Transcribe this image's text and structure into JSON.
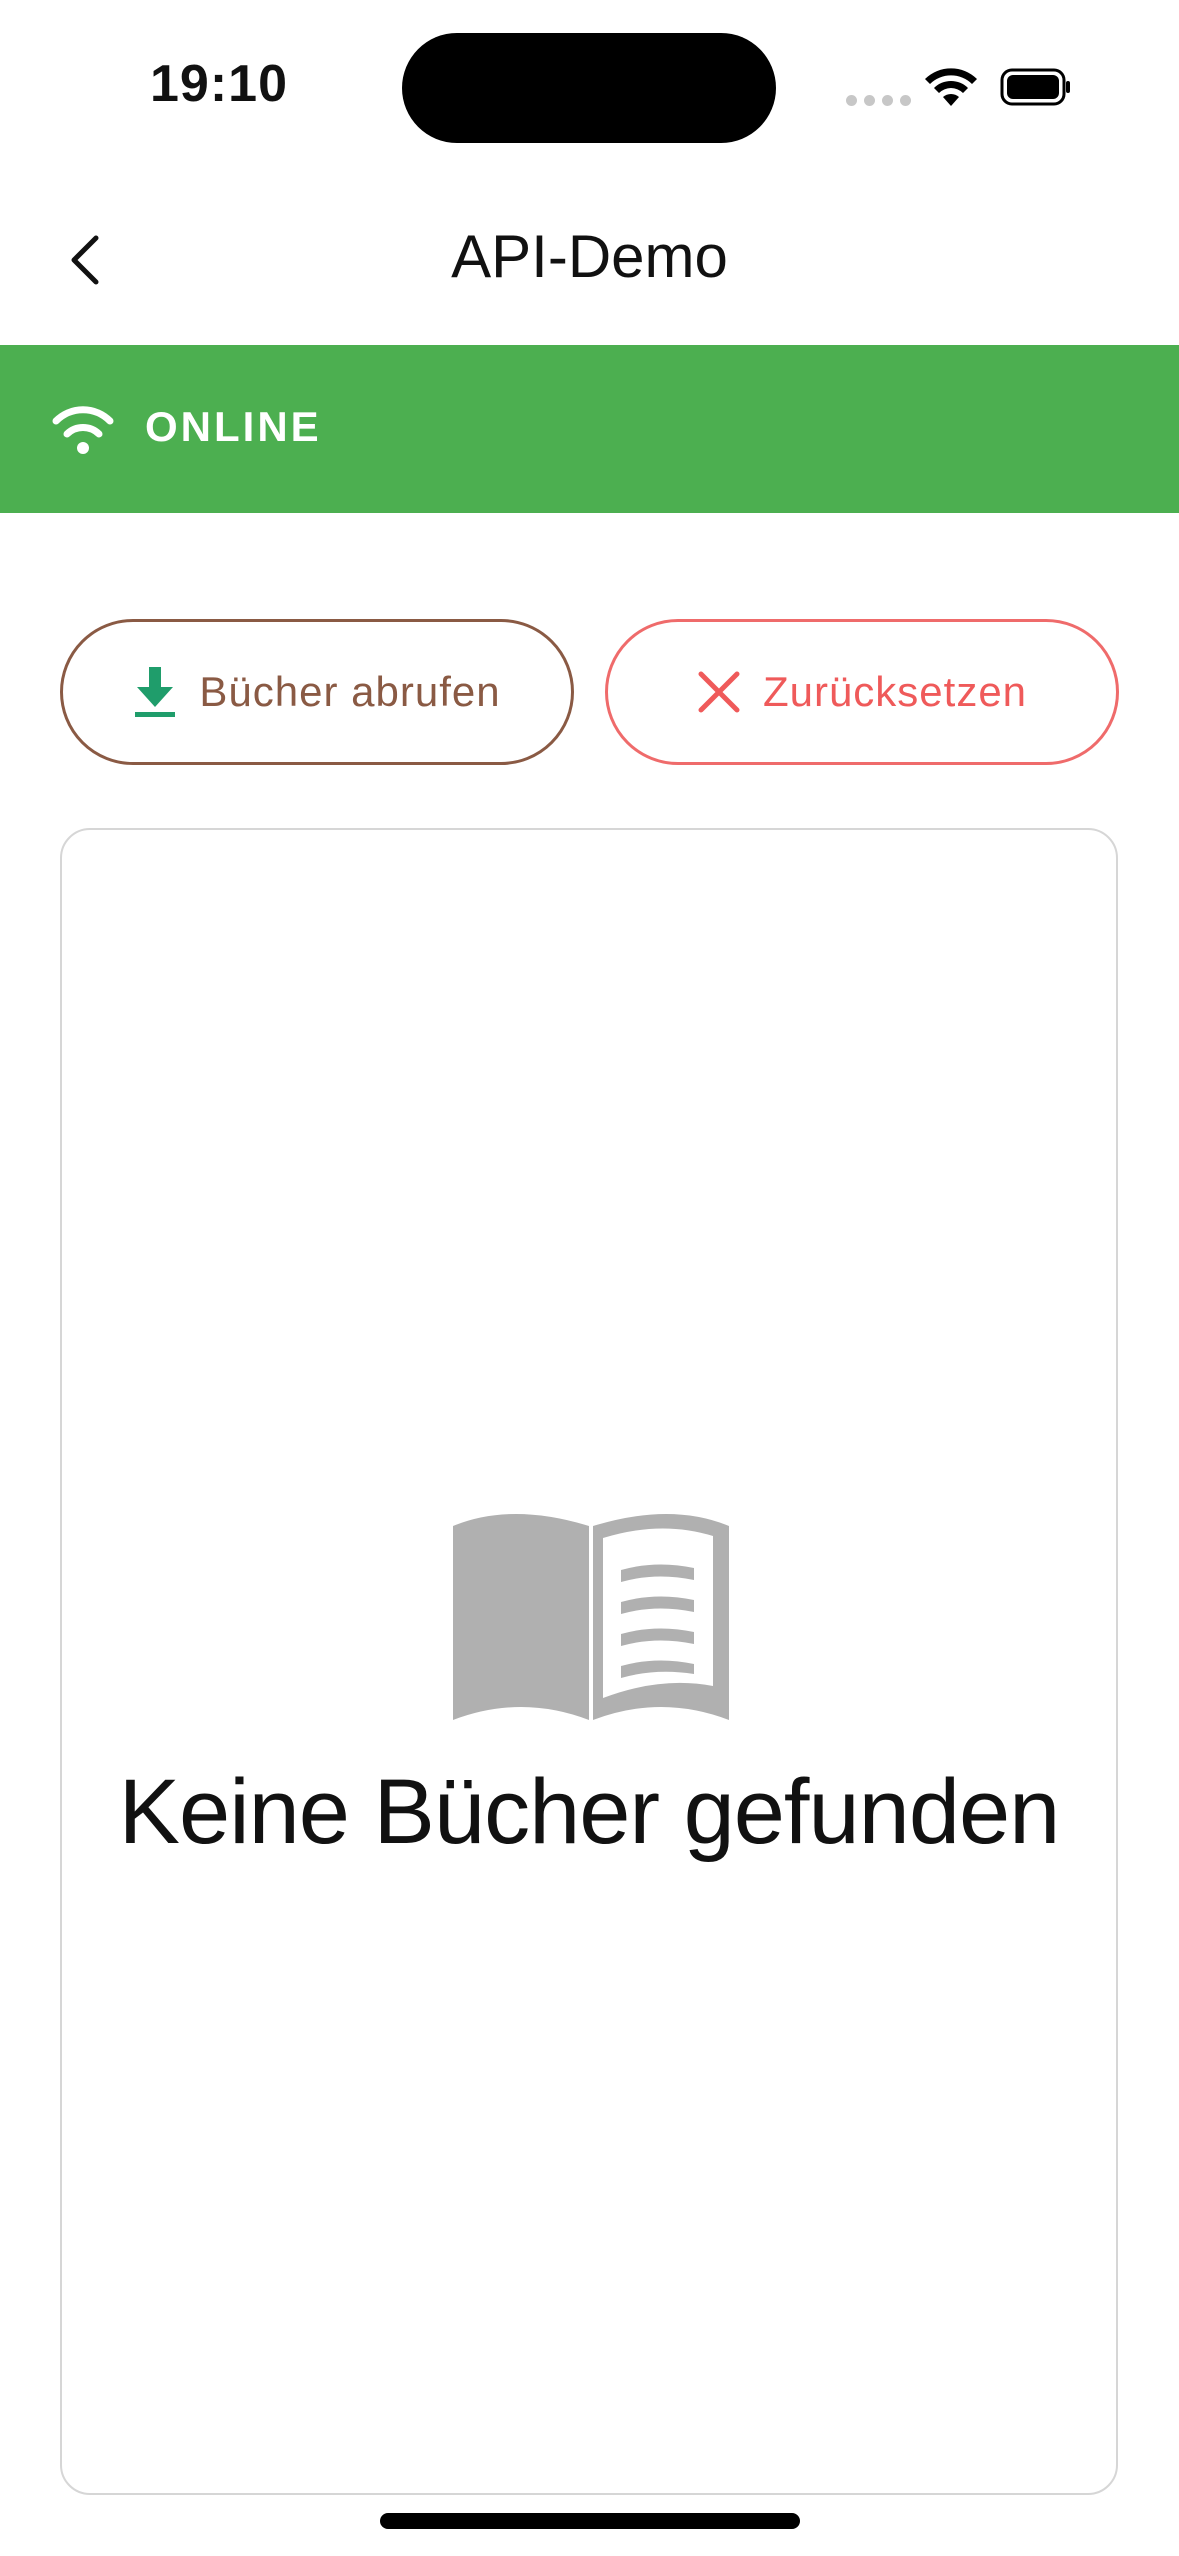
{
  "status_bar": {
    "time": "19:10",
    "icons": [
      "cellular-dots-icon",
      "wifi-icon",
      "battery-icon"
    ]
  },
  "nav": {
    "title": "API-Demo",
    "back_icon": "chevron-left-icon"
  },
  "connection": {
    "label": "ONLINE",
    "icon": "wifi-icon",
    "color": "#4caf50"
  },
  "actions": {
    "fetch_label": "Bücher abrufen",
    "fetch_icon": "download-icon",
    "fetch_color": "#8a5a44",
    "fetch_icon_color": "#1f9d6b",
    "reset_label": "Zurücksetzen",
    "reset_icon": "close-icon",
    "reset_color": "#ef5a5a"
  },
  "empty_state": {
    "icon": "open-book-icon",
    "message": "Keine Bücher gefunden",
    "icon_color": "#b0b0b0"
  }
}
